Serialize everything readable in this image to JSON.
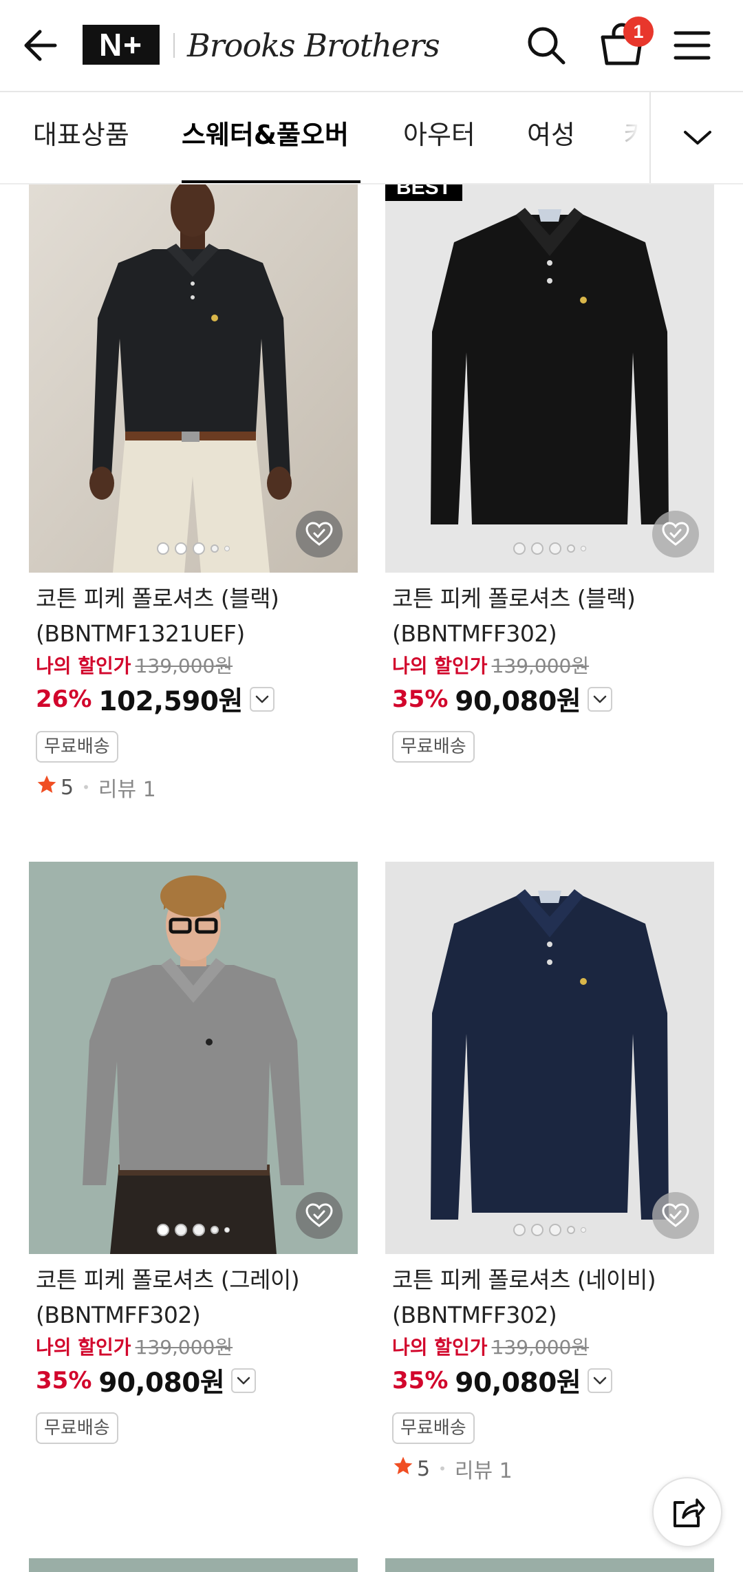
{
  "header": {
    "np_logo": "N+",
    "brand": "Brooks Brothers",
    "cart_count": "1"
  },
  "tabs": [
    "대표상품",
    "스웨터&풀오버",
    "아우터",
    "여성",
    "키"
  ],
  "products": [
    {
      "name": "코튼 피케 폴로셔츠 (블랙) (BBNTMF1321UEF)",
      "my_price_label": "나의 할인가",
      "original_price": "139,000원",
      "discount": "26%",
      "final_price": "102,590원",
      "shipping": "무료배송",
      "rating": "5",
      "reviews": "리뷰 1",
      "best": "",
      "image_bg": "#d9d2c7",
      "shirt_color": "#1e2022"
    },
    {
      "name": "코튼 피케 폴로셔츠 (블랙) (BBNTMFF302)",
      "my_price_label": "나의 할인가",
      "original_price": "139,000원",
      "discount": "35%",
      "final_price": "90,080원",
      "shipping": "무료배송",
      "rating": "",
      "reviews": "",
      "best": "BEST",
      "image_bg": "#e5e5e5",
      "shirt_color": "#161616"
    },
    {
      "name": "코튼 피케 폴로셔츠 (그레이) (BBNTMFF302)",
      "my_price_label": "나의 할인가",
      "original_price": "139,000원",
      "discount": "35%",
      "final_price": "90,080원",
      "shipping": "무료배송",
      "rating": "",
      "reviews": "",
      "best": "",
      "image_bg": "#9fb2aa",
      "shirt_color": "#8c8c8c"
    },
    {
      "name": "코튼 피케 폴로셔츠 (네이비) (BBNTMFF302)",
      "my_price_label": "나의 할인가",
      "original_price": "139,000원",
      "discount": "35%",
      "final_price": "90,080원",
      "shipping": "무료배송",
      "rating": "5",
      "reviews": "리뷰 1",
      "best": "",
      "image_bg": "#e3e3e3",
      "shirt_color": "#1b2740"
    }
  ]
}
